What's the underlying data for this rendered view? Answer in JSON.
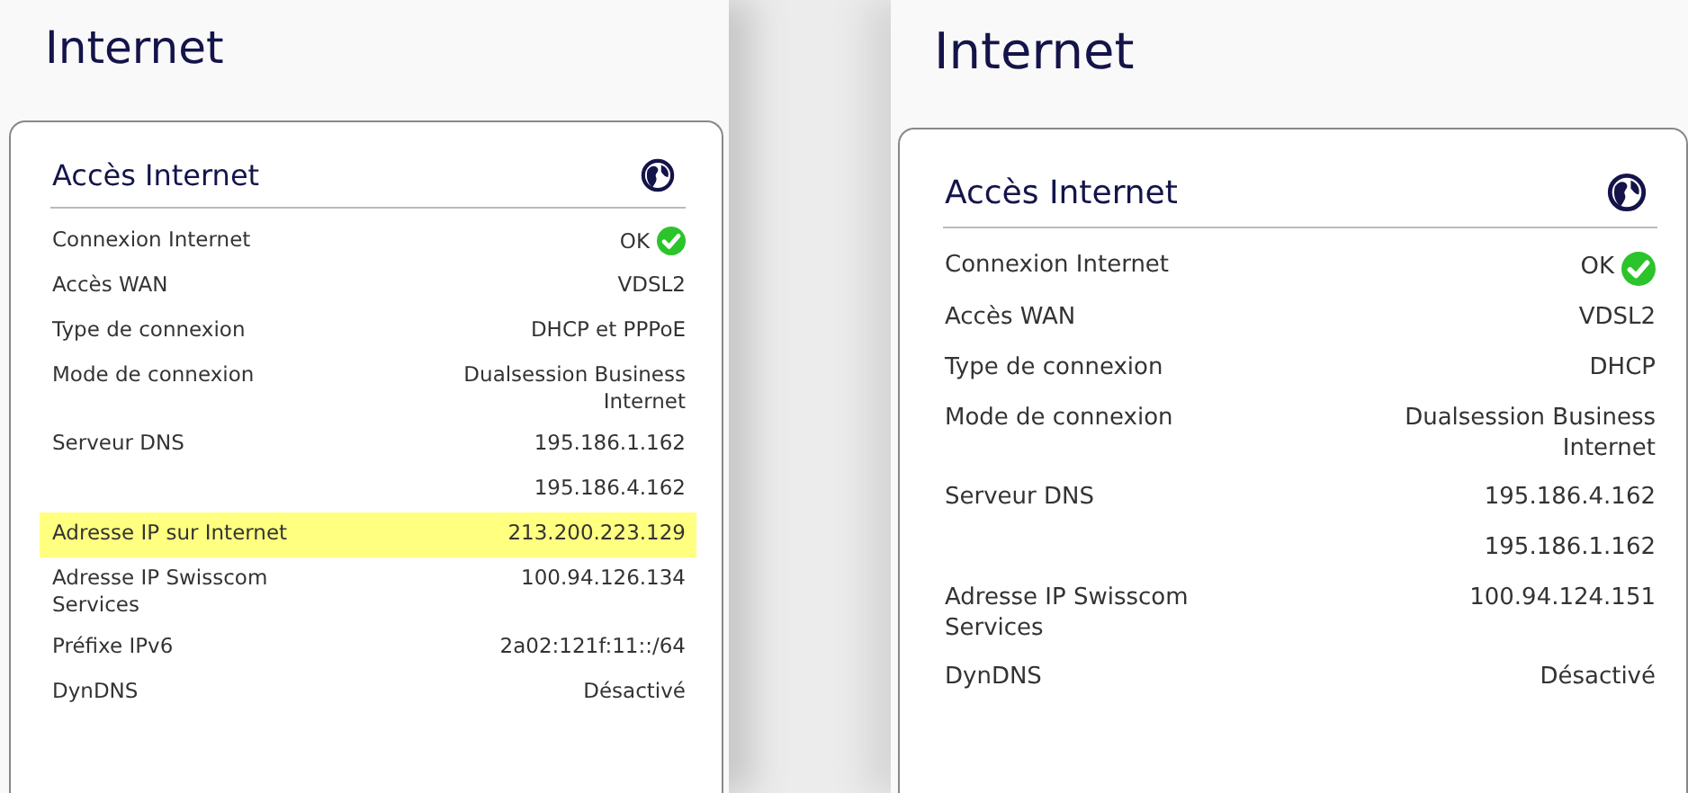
{
  "panels": [
    {
      "title": "Internet",
      "card_title": "Accès Internet",
      "rows": [
        {
          "kind": "status",
          "label": "Connexion Internet",
          "value": "OK",
          "highlighted": false
        },
        {
          "kind": "text",
          "label": "Accès WAN",
          "value": "VDSL2",
          "highlighted": false
        },
        {
          "kind": "text",
          "label": "Type de connexion",
          "value": "DHCP et PPPoE",
          "highlighted": false
        },
        {
          "kind": "text",
          "label": "Mode de connexion",
          "value": "Dualsession Business Internet",
          "highlighted": false
        },
        {
          "kind": "text",
          "label": "Serveur DNS",
          "value": "195.186.1.162",
          "highlighted": false
        },
        {
          "kind": "text",
          "value": "195.186.4.162",
          "highlighted": false
        },
        {
          "kind": "text",
          "label": "Adresse IP sur Internet",
          "value": "213.200.223.129",
          "highlighted": true
        },
        {
          "kind": "text",
          "label": "Adresse IP Swisscom Services",
          "value": "100.94.126.134",
          "highlighted": false
        },
        {
          "kind": "text",
          "label": "Préfixe IPv6",
          "value": "2a02:121f:11::/64",
          "highlighted": false
        },
        {
          "kind": "text",
          "label": "DynDNS",
          "value": "Désactivé",
          "highlighted": false
        }
      ]
    },
    {
      "title": "Internet",
      "card_title": "Accès Internet",
      "rows": [
        {
          "kind": "status",
          "label": "Connexion Internet",
          "value": "OK",
          "highlighted": false
        },
        {
          "kind": "text",
          "label": "Accès WAN",
          "value": "VDSL2",
          "highlighted": false
        },
        {
          "kind": "text",
          "label": "Type de connexion",
          "value": "DHCP",
          "highlighted": false
        },
        {
          "kind": "text",
          "label": "Mode de connexion",
          "value": "Dualsession Business Internet",
          "highlighted": false
        },
        {
          "kind": "text",
          "label": "Serveur DNS",
          "value": "195.186.4.162",
          "highlighted": false
        },
        {
          "kind": "text",
          "value": "195.186.1.162",
          "highlighted": false
        },
        {
          "kind": "text",
          "label": "Adresse IP Swisscom Services",
          "value": "100.94.124.151",
          "highlighted": false
        },
        {
          "kind": "text",
          "label": "DynDNS",
          "value": "Désactivé",
          "highlighted": false
        }
      ]
    }
  ]
}
